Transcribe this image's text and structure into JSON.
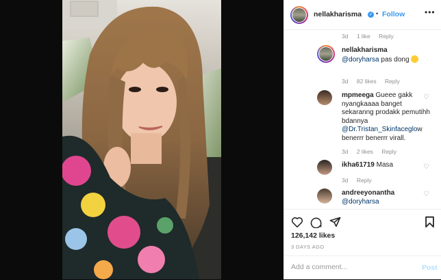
{
  "post": {
    "username": "nellakharisma",
    "verified_icon": "verified-badge-icon",
    "separator": "•",
    "follow_label": "Follow",
    "more_icon": "more-options-icon"
  },
  "comments": [
    {
      "age": "3d",
      "likes": "1 like",
      "reply": "Reply"
    },
    {
      "username": "nellakharisma",
      "mention": "@doryharsa",
      "text": "pas dong",
      "age": "3d",
      "likes": "82 likes",
      "reply": "Reply"
    },
    {
      "username": "mpmeega",
      "text": "Gueee gakk nyangkaaaa banget sekaranng prodakk pemutihh bdannya",
      "mention": "@Dr.Tristan_Skinfaceglo",
      "text_after": "w benerrr benerrr virall.",
      "age": "3d",
      "likes": "2 likes",
      "reply": "Reply"
    },
    {
      "username": "ikha61719",
      "text": "Masa",
      "age": "3d",
      "reply": "Reply"
    },
    {
      "username": "andreeyonantha",
      "mention": "@doryharsa"
    }
  ],
  "actions": {
    "like_icon": "heart-icon",
    "comment_icon": "comment-icon",
    "share_icon": "share-icon",
    "save_icon": "bookmark-icon",
    "likes_count": "126,142 likes",
    "timestamp": "3 DAYS AGO",
    "add_comment_placeholder": "Add a comment...",
    "post_label": "Post"
  },
  "colors": {
    "accent": "#3897f0",
    "mention": "#003569",
    "muted": "#8e8e8e",
    "post_disabled": "#b2dffc"
  }
}
